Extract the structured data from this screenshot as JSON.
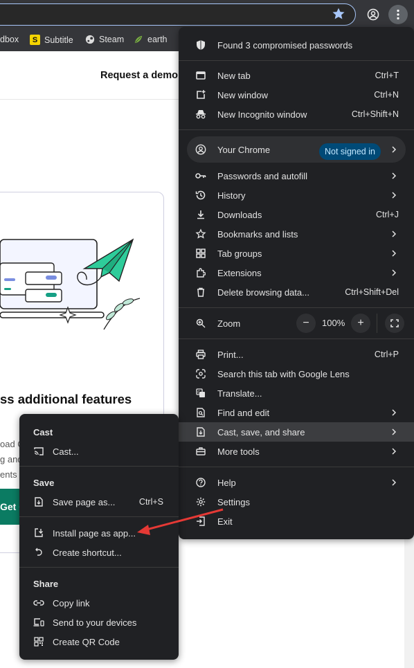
{
  "browser": {
    "bookmarks": [
      {
        "label": "dbox",
        "icon": "bookmark-icon"
      },
      {
        "label": "Subtitle",
        "icon": "subtitle-logo-icon",
        "color": "#f5d400"
      },
      {
        "label": "Steam",
        "icon": "steam-icon"
      },
      {
        "label": "earth",
        "icon": "earth-icon"
      }
    ]
  },
  "page": {
    "request_demo": "Request a demo",
    "card_title": "ss additional features",
    "card_lines": [
      "oad C",
      "g and",
      "ents"
    ],
    "cta": "Get G"
  },
  "main_menu": {
    "passwords_alert": "Found 3 compromised passwords",
    "group1": [
      {
        "label": "New tab",
        "shortcut": "Ctrl+T",
        "icon": "new-tab-icon"
      },
      {
        "label": "New window",
        "shortcut": "Ctrl+N",
        "icon": "new-window-icon"
      },
      {
        "label": "New Incognito window",
        "shortcut": "Ctrl+Shift+N",
        "icon": "incognito-icon"
      }
    ],
    "your_chrome": {
      "label": "Your Chrome",
      "badge": "Not signed in"
    },
    "group2": [
      {
        "label": "Passwords and autofill",
        "shortcut": "",
        "submenu": true,
        "icon": "key-icon"
      },
      {
        "label": "History",
        "shortcut": "",
        "submenu": true,
        "icon": "history-icon"
      },
      {
        "label": "Downloads",
        "shortcut": "Ctrl+J",
        "submenu": false,
        "icon": "download-icon"
      },
      {
        "label": "Bookmarks and lists",
        "shortcut": "",
        "submenu": true,
        "icon": "star-icon"
      },
      {
        "label": "Tab groups",
        "shortcut": "",
        "submenu": true,
        "icon": "tab-groups-icon"
      },
      {
        "label": "Extensions",
        "shortcut": "",
        "submenu": true,
        "icon": "puzzle-icon"
      },
      {
        "label": "Delete browsing data...",
        "shortcut": "Ctrl+Shift+Del",
        "submenu": false,
        "icon": "trash-icon"
      }
    ],
    "zoom": {
      "label": "Zoom",
      "value": "100%",
      "minus": "−",
      "plus": "+"
    },
    "group3": [
      {
        "label": "Print...",
        "shortcut": "Ctrl+P",
        "submenu": false,
        "icon": "print-icon"
      },
      {
        "label": "Search this tab with Google Lens",
        "shortcut": "",
        "submenu": false,
        "icon": "lens-icon"
      },
      {
        "label": "Translate...",
        "shortcut": "",
        "submenu": false,
        "icon": "translate-icon"
      },
      {
        "label": "Find and edit",
        "shortcut": "",
        "submenu": true,
        "icon": "find-icon"
      },
      {
        "label": "Cast, save, and share",
        "shortcut": "",
        "submenu": true,
        "icon": "cast-save-icon"
      },
      {
        "label": "More tools",
        "shortcut": "",
        "submenu": true,
        "icon": "toolbox-icon"
      }
    ],
    "group4": [
      {
        "label": "Help",
        "shortcut": "",
        "submenu": true,
        "icon": "help-icon"
      },
      {
        "label": "Settings",
        "shortcut": "",
        "submenu": false,
        "icon": "settings-icon"
      },
      {
        "label": "Exit",
        "shortcut": "",
        "submenu": false,
        "icon": "exit-icon"
      }
    ]
  },
  "sub_menu": {
    "cast_heading": "Cast",
    "cast": {
      "label": "Cast...",
      "icon": "cast-icon"
    },
    "save_heading": "Save",
    "save": {
      "label": "Save page as...",
      "shortcut": "Ctrl+S",
      "icon": "save-page-icon"
    },
    "install": {
      "label": "Install page as app...",
      "icon": "install-app-icon"
    },
    "shortcut": {
      "label": "Create shortcut...",
      "icon": "shortcut-icon"
    },
    "share_heading": "Share",
    "share": [
      {
        "label": "Copy link",
        "icon": "link-icon"
      },
      {
        "label": "Send to your devices",
        "icon": "devices-icon"
      },
      {
        "label": "Create QR Code",
        "icon": "qr-code-icon"
      }
    ]
  },
  "colors": {
    "menu_bg": "#202124",
    "highlight": "#3c3d40",
    "badge_bg": "#004a77",
    "badge_fg": "#c2e7ff",
    "accent_green": "#0b7b62",
    "annotation_arrow": "#e53935"
  }
}
